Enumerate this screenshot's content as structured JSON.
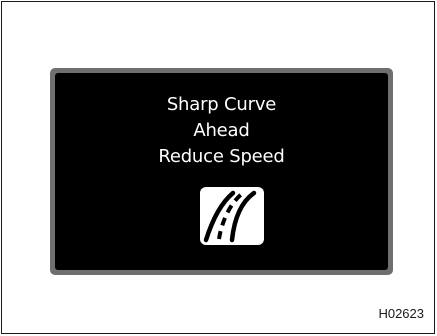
{
  "display": {
    "line1": "Sharp Curve",
    "line2": "Ahead",
    "line3": "Reduce Speed",
    "icon": "sharp-curve-road-icon"
  },
  "figure_code": "H02623",
  "colors": {
    "screen": "#000000",
    "bezel": "#6f6f6f",
    "text": "#ffffff",
    "icon_background": "#ffffff",
    "icon_foreground": "#000000"
  }
}
